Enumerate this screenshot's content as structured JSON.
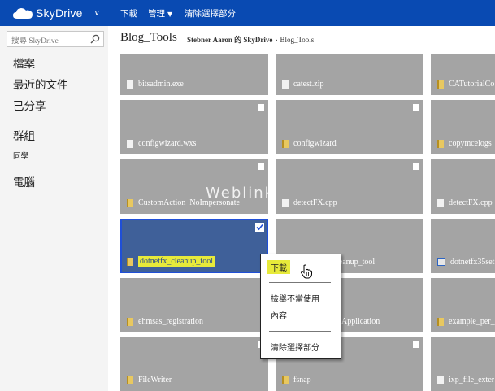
{
  "topbar": {
    "brand": "SkyDrive",
    "commands": {
      "download": "下載",
      "manage": "管理",
      "clear_selection": "清除選擇部分"
    },
    "color": "#094ab2"
  },
  "leftnav": {
    "search_placeholder": "搜尋 SkyDrive",
    "files": "檔案",
    "recent_docs": "最近的文件",
    "shared": "已分享",
    "groups": "群組",
    "group_item": "同學",
    "pcs": "電腦"
  },
  "header": {
    "title": "Blog_Tools",
    "breadcrumb_owner": "Stebner Aaron 的 SkyDrive",
    "breadcrumb_sep": "›",
    "breadcrumb_current": "Blog_Tools"
  },
  "tiles": {
    "r1c1": "bitsadmin.exe",
    "r1c2": "catest.zip",
    "r1c3": "CATutorialCo",
    "r2c1": "configwizard.wxs",
    "r2c2": "configwizard",
    "r2c3": "copymcelogs",
    "r3c1": "CustomAction_NoImpersonate",
    "r3c2": "detectFX.cpp",
    "r3c3": "detectFX.cpp",
    "r4c1": "dotnetfx_cleanup_tool",
    "r4c2": "leanup_tool",
    "r4c3": "dotnetfx35set",
    "r5c1": "ehmsas_registration",
    "r5c2": "Application",
    "r5c3": "example_per_",
    "r6c1": "FileWriter",
    "r6c2": "fsnap",
    "r6c3": "ixp_file_exter"
  },
  "watermark": "Weblink",
  "context_menu": {
    "download": "下載",
    "report": "檢舉不當使用",
    "properties": "內容",
    "clear_selection": "清除選擇部分",
    "highlight_color": "#e7ea3a"
  }
}
